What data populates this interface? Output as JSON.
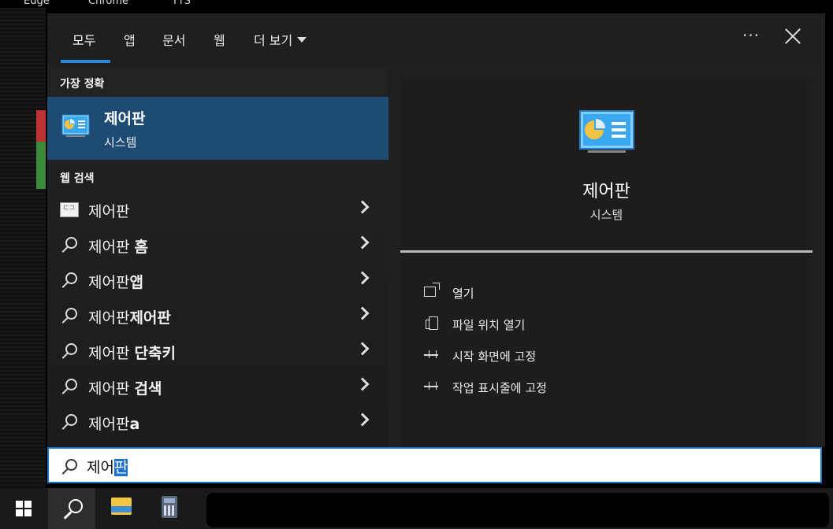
{
  "desktop": {
    "icon_labels": [
      "Edge",
      "Chrome",
      "TTS"
    ]
  },
  "tabs": [
    {
      "label": "모두",
      "active": true
    },
    {
      "label": "앱"
    },
    {
      "label": "문서"
    },
    {
      "label": "웹"
    },
    {
      "label": "더 보기"
    }
  ],
  "topbar": {
    "more_label": "···"
  },
  "best_match": {
    "heading": "가장 정확",
    "title": "제어판",
    "subtitle": "시스템"
  },
  "web_search": {
    "heading": "웹 검색",
    "items": [
      {
        "base": "제어판",
        "bold": ""
      },
      {
        "base": "제어판 ",
        "bold": "홈"
      },
      {
        "base": "제어판",
        "bold": "앱"
      },
      {
        "base": "제어판",
        "bold": "제어판"
      },
      {
        "base": "제어판 ",
        "bold": "단축키"
      },
      {
        "base": "제어판 ",
        "bold": "검색"
      },
      {
        "base": "제어판",
        "bold": "a"
      }
    ]
  },
  "detail": {
    "title": "제어판",
    "subtitle": "시스템",
    "actions": [
      {
        "label": "열기",
        "icon": "open-icon"
      },
      {
        "label": "파일 위치 열기",
        "icon": "file-location-icon"
      },
      {
        "label": "시작 화면에 고정",
        "icon": "pin-icon"
      },
      {
        "label": "작업 표시줄에 고정",
        "icon": "pin-icon"
      }
    ]
  },
  "search": {
    "query_prefix": "제어",
    "query_selected": "판"
  },
  "colors": {
    "accent": "#1a73c8",
    "selected_row": "#1e4b73",
    "panel_bg": "#202020"
  }
}
